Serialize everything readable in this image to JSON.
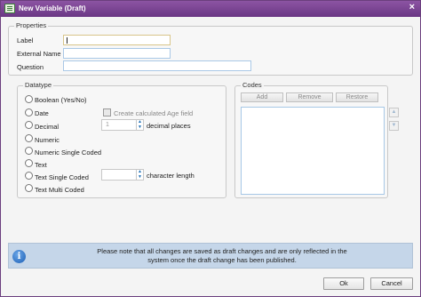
{
  "window": {
    "title": "New Variable (Draft)",
    "close_glyph": "×"
  },
  "properties": {
    "legend": "Properties",
    "label_caption": "Label",
    "label_value": "",
    "external_name_caption": "External Name",
    "external_name_value": "",
    "question_caption": "Question",
    "question_value": ""
  },
  "datatype": {
    "legend": "Datatype",
    "options": [
      "Boolean (Yes/No)",
      "Date",
      "Decimal",
      "Numeric",
      "Numeric Single Coded",
      "Text",
      "Text Single Coded",
      "Text Multi Coded"
    ],
    "create_age_label": "Create calculated Age field",
    "decimal_value": "1",
    "decimal_places_label": "decimal places",
    "char_length_value": "",
    "character_length_label": "character length"
  },
  "codes": {
    "legend": "Codes",
    "add_label": "Add",
    "remove_label": "Remove",
    "restore_label": "Restore"
  },
  "notice": {
    "line1": "Please note that all changes are saved as draft changes and are only reflected in the",
    "line2": "system once the draft change has been published."
  },
  "footer": {
    "ok_label": "Ok",
    "cancel_label": "Cancel"
  },
  "icons": [
    "window-icon",
    "close-icon",
    "info-icon",
    "spin-up-icon",
    "spin-down-icon",
    "move-up-icon",
    "move-down-icon"
  ]
}
